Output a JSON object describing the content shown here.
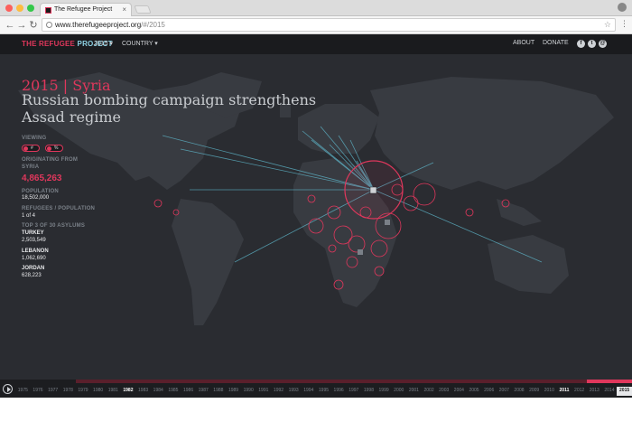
{
  "browser": {
    "tab_title": "The Refugee Project",
    "close_glyph": "×",
    "url_domain": "www.therefugeeproject.org",
    "url_path": "/#/2015"
  },
  "header": {
    "logo_part1": "THE REFUGEE",
    "logo_part2": "PROJECT",
    "year_menu": "2015 ▾",
    "country_menu": "COUNTRY ▾",
    "about": "ABOUT",
    "donate": "DONATE",
    "social_icons": [
      "facebook-icon",
      "twitter-icon",
      "email-icon"
    ]
  },
  "panel": {
    "year_country": "2015 | Syria",
    "headline": "Russian bombing campaign strengthens Assad regime",
    "viewing_label": "VIEWING",
    "view_chip1_text": "#",
    "view_chip2_text": "%",
    "originating_label": "ORIGINATING FROM",
    "originating_country": "SYRIA",
    "refugee_count": "4,865,263",
    "population_label": "POPULATION",
    "population_value": "18,502,000",
    "ratio_label": "REFUGEES / POPULATION",
    "ratio_value": "1 of 4",
    "asylums_label": "TOP 3 OF 30 ASYLUMS",
    "asylums": [
      {
        "country": "TURKEY",
        "count": "2,503,549"
      },
      {
        "country": "LEBANON",
        "count": "1,062,690"
      },
      {
        "country": "JORDAN",
        "count": "628,223"
      }
    ]
  },
  "timeline": {
    "years": [
      "1975",
      "1976",
      "1977",
      "1978",
      "1979",
      "1980",
      "1981",
      "1982",
      "1983",
      "1984",
      "1985",
      "1986",
      "1987",
      "1988",
      "1989",
      "1990",
      "1991",
      "1992",
      "1993",
      "1994",
      "1995",
      "1996",
      "1997",
      "1998",
      "1999",
      "2000",
      "2001",
      "2002",
      "2003",
      "2004",
      "2005",
      "2006",
      "2007",
      "2008",
      "2009",
      "2010",
      "2011",
      "2012",
      "2013",
      "2014",
      "2015"
    ],
    "bold_years": [
      "1982",
      "2011"
    ],
    "active_year": "2015"
  },
  "colors": {
    "accent": "#e0375c",
    "accent_light": "#8fd4e6",
    "background": "#232529"
  }
}
